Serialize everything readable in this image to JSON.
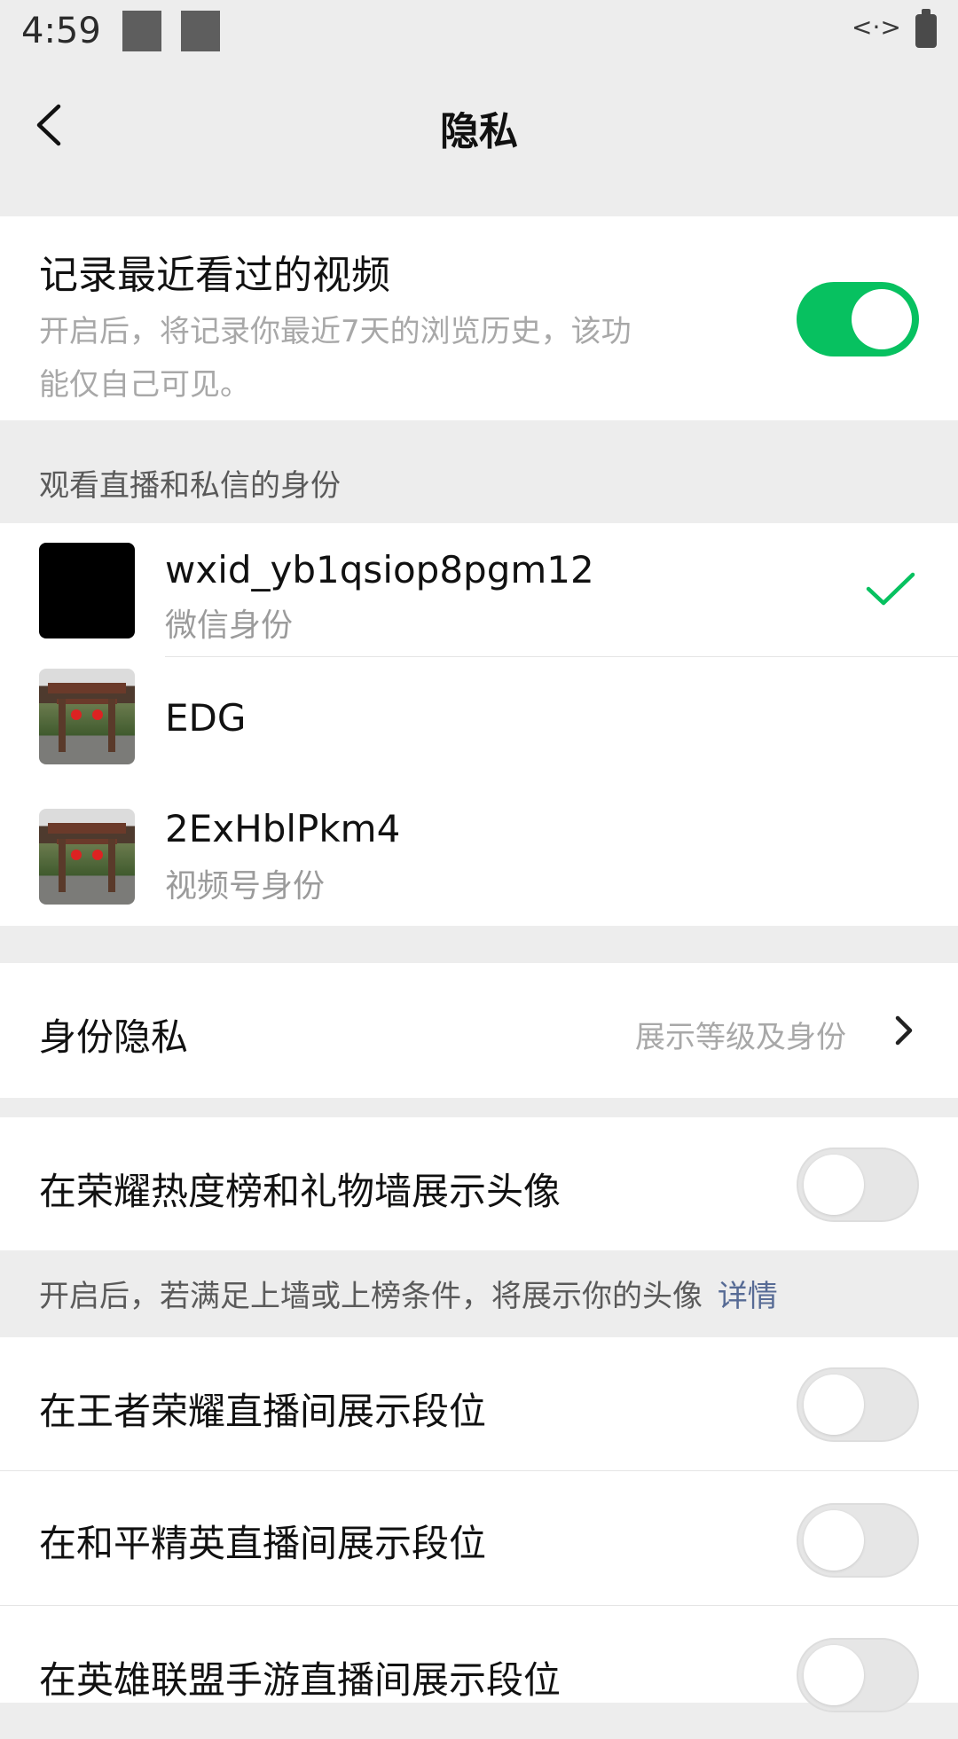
{
  "status_bar": {
    "time": "4:59",
    "network": "<·>"
  },
  "nav": {
    "title": "隐私",
    "back_icon": "back-arrow-icon"
  },
  "record_video": {
    "title": "记录最近看过的视频",
    "desc_line1": "开启后，将记录你最近7天的浏览历史，该功",
    "desc_line2": "能仅自己可见。",
    "enabled": true
  },
  "identity_section": {
    "header": "观看直播和私信的身份",
    "items": [
      {
        "name": "wxid_yb1qsiop8pgm12",
        "sub": "微信身份",
        "selected": true
      },
      {
        "name": "EDG",
        "sub": "",
        "selected": false
      },
      {
        "name": "2ExHblPkm4",
        "sub": "视频号身份",
        "selected": false
      }
    ]
  },
  "identity_privacy": {
    "label": "身份隐私",
    "value": "展示等级及身份"
  },
  "honor_wall": {
    "label": "在荣耀热度榜和礼物墙展示头像",
    "enabled": false,
    "note": "开启后，若满足上墙或上榜条件，将展示你的头像",
    "note_link": "详情"
  },
  "rank_toggles": [
    {
      "label": "在王者荣耀直播间展示段位",
      "enabled": false
    },
    {
      "label": "在和平精英直播间展示段位",
      "enabled": false
    },
    {
      "label": "在英雄联盟手游直播间展示段位",
      "enabled": false
    }
  ],
  "colors": {
    "accent": "#07c160",
    "link": "#576b95",
    "background": "#ededed"
  }
}
